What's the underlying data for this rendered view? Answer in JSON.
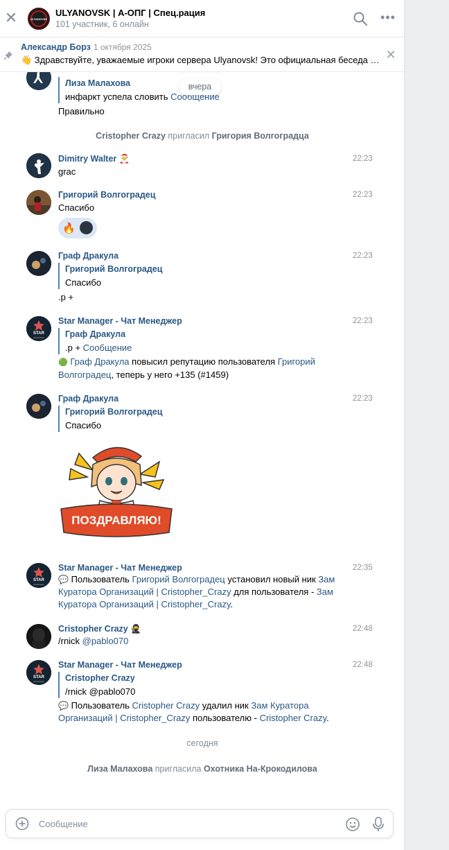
{
  "header": {
    "avatar_text": "ULYANOVSK",
    "title": "ULYANOVSK | А-ОПГ | Спец.рация",
    "subtitle": "101 участник, 6 онлайн"
  },
  "pinned": {
    "author": "Александр Борз",
    "date": "1 октября 2025",
    "text": "👋 Здравствуйте, уважаемые игроки сервера Ulyanovsk! Это официальная беседа …"
  },
  "feed": {
    "date_pill": "вчера",
    "top_reply": {
      "name": "Лиза Малахова",
      "text": "инфаркт успела словить ",
      "link": "Сообщение"
    },
    "top_text": "Правильно",
    "sys1": {
      "actor": "Cristopher Crazy",
      "verb": " пригласил ",
      "target": "Григория Волгоградца"
    },
    "m1": {
      "name": "Dimitry Walter 🎅",
      "time": "22:23",
      "text": "grac"
    },
    "m2": {
      "name": "Григорий Волгоградец",
      "time": "22:23",
      "text": "Спасибо",
      "reaction_emoji": "🔥"
    },
    "m3": {
      "name": "Граф Дракула",
      "time": "22:23",
      "reply_name": "Григорий Волгоградец",
      "reply_text": "Спасибо",
      "text": ".р +"
    },
    "m4": {
      "name": "Star Manager - Чат Менеджер",
      "time": "22:23",
      "reply_name": "Граф Дракула",
      "reply_text": ".р + ",
      "reply_link": "Сообщение",
      "l1_icon": "🟢",
      "l1_user": "Граф Дракула",
      "l1_text": " повысил репутацию пользователя ",
      "l1_target": "Григорий",
      "l2_target": "Волгоградец",
      "l2_text": ", теперь у него +135 (#1459)"
    },
    "m5": {
      "name": "Граф Дракула",
      "time": "22:23",
      "reply_name": "Григорий Волгоградец",
      "reply_text": "Спасибо",
      "sticker_text": "ПОЗДРАВЛЯЮ!"
    },
    "m6": {
      "name": "Star Manager - Чат Менеджер",
      "time": "22:35",
      "l1_icon": "💬",
      "l1_text": " Пользователь ",
      "l1_user": "Григорий Волгоградец",
      "l1_text2": " установил новый ник ",
      "l1_link": "Зам",
      "l2_link": "Куратора Организаций | Cristopher_Crazy",
      "l2_text": " для пользователя - ",
      "l2_link2": "Зам",
      "l3_link": "Куратора Организаций | Cristopher_Crazy",
      "l3_text": "."
    },
    "m7": {
      "name": "Cristopher Crazy 🥷",
      "time": "22:48",
      "text": "/rnick ",
      "mention": "@pablo070"
    },
    "m8": {
      "name": "Star Manager - Чат Менеджер",
      "time": "22:48",
      "reply_name": "Cristopher Crazy",
      "reply_text": "/rnick @pablo070",
      "l1_icon": "💬",
      "l1_text": " Пользователь ",
      "l1_user": "Cristopher Crazy",
      "l1_text2": " удалил ник ",
      "l1_link": "Зам Куратора",
      "l2_link": "Организаций | Cristopher_Crazy",
      "l2_text": " пользователю - ",
      "l2_user": "Cristopher Crazy",
      "l2_end": "."
    },
    "divider_today": "сегодня",
    "sys2": {
      "actor": "Лиза Малахова",
      "verb": " пригласила ",
      "target": "Охотника На-Крокодилова"
    },
    "star_logo_text": "STAR",
    "star_logo_sub": "MANAGER"
  },
  "composer": {
    "placeholder": "Сообщение"
  }
}
